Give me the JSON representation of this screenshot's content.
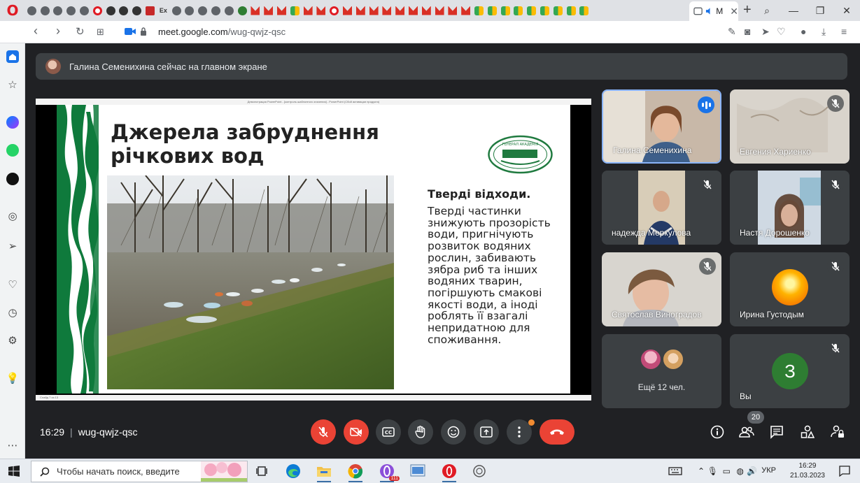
{
  "browser": {
    "active_tab_title": "M",
    "url_prefix": "meet.google.com",
    "url_path": "/wug-qwjz-qsc",
    "tab_favicons": [
      "gray",
      "gray",
      "gray",
      "gray",
      "gray",
      "opera",
      "w",
      "w",
      "w",
      "red",
      "ex",
      "gray",
      "gray",
      "gray",
      "gray",
      "gray",
      "green",
      "gmail",
      "gmail",
      "gmail",
      "meet",
      "gmail",
      "gmail",
      "opera",
      "gmail",
      "gmail",
      "gmail",
      "gmail",
      "gmail",
      "gmail",
      "gmail",
      "gmail",
      "gmail",
      "gmail",
      "meet",
      "meet",
      "meet",
      "meet",
      "meet",
      "meet",
      "meet",
      "meet",
      "meet"
    ],
    "ex_label": "Ex"
  },
  "meet": {
    "presenter_banner": "Галина Семенихина сейчас на главном экране",
    "time": "16:29",
    "meeting_code": "wug-qwjz-qsc",
    "people_count": "20",
    "participants": [
      {
        "name": "Галина Семенихина",
        "speaking": true
      },
      {
        "name": "Евгения Хариенко",
        "speaking": false
      },
      {
        "name": "надежда Меркулова",
        "speaking": false
      },
      {
        "name": "Настя Дорошенко",
        "speaking": false
      },
      {
        "name": "Святослав Виноградов",
        "speaking": false
      },
      {
        "name": "Ирина Густодым",
        "speaking": false
      }
    ],
    "more_tile": {
      "label": "Ещё 12 чел."
    },
    "self_tile": {
      "name": "Вы",
      "initial": "З",
      "avatar_color": "#2e7d32"
    }
  },
  "slide": {
    "title": "Джерела забруднення річкових вод",
    "body_heading": "Тверді відходи.",
    "body_text": "Тверді частинки знижують прозорість води, пригнічують розвиток водяних рослин, забивають зябра риб та інших водяних тварин, погіршують смакові якості води, а іноді роблять її взагалі непридатною для споживання.",
    "seal_text": "ГЕНЕРАЛ АКАДЕМІЯ",
    "ppt_title": "Демонстрация PowerPoint - [контроль шаблонного значения] - PowerPoint (Сбой активации продукта)",
    "ppt_status": "Слайд 7 из 13"
  },
  "taskbar": {
    "search_placeholder": "Чтобы начать поиск, введите",
    "badge_opera_gx": "111",
    "lang": "УКР",
    "time": "16:29",
    "date": "21.03.2023"
  },
  "colors": {
    "meet_bg": "#202124",
    "tile_bg": "#3c4043",
    "mic_red": "#ea4335",
    "speaking_border": "#8ab4f8",
    "stripe_green": "#0f7a3c"
  }
}
